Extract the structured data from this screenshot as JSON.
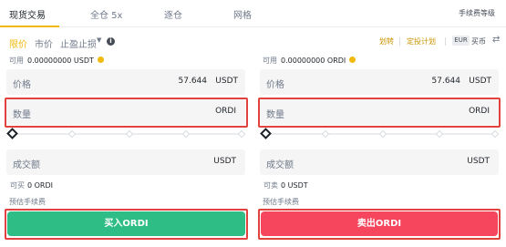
{
  "tabs": {
    "items": [
      {
        "label": "现货交易"
      },
      {
        "label": "全仓 5x"
      },
      {
        "label": "逐仓"
      },
      {
        "label": "网格"
      }
    ],
    "fee_link": "手续费等级"
  },
  "order_types": {
    "limit": "限价",
    "market": "市价",
    "stop": "止盈止损",
    "links": {
      "auto_invest": "划转",
      "recurring": "定投计划"
    },
    "currency": "EUR",
    "buy_sell": "买币"
  },
  "buy": {
    "available_label": "可用",
    "available_value": "0.00000000 USDT",
    "price_label": "价格",
    "price_value": "57.644",
    "price_unit": "USDT",
    "qty_label": "数量",
    "qty_unit": "ORDI",
    "total_label": "成交额",
    "total_unit": "USDT",
    "can_buy_label": "可买",
    "can_buy_value": "0 ORDI",
    "fee_label": "预估手续费",
    "button_label": "买入ORDI"
  },
  "sell": {
    "available_label": "可用",
    "available_value": "0.00000000 ORDI",
    "price_label": "价格",
    "price_value": "57.644",
    "price_unit": "USDT",
    "qty_label": "数量",
    "qty_unit": "ORDI",
    "total_label": "成交额",
    "total_unit": "USDT",
    "can_sell_label": "可卖",
    "can_sell_value": "0 USDT",
    "fee_label": "预估手续费",
    "button_label": "卖出ORDI"
  },
  "icons": {
    "info": "info-icon",
    "coin": "coin-icon",
    "swap": "swap-icon",
    "caret": "caret-down-icon"
  },
  "colors": {
    "accent": "#f0b90b",
    "buy": "#2ebd85",
    "sell": "#f6465d",
    "highlight": "#e0433d"
  }
}
